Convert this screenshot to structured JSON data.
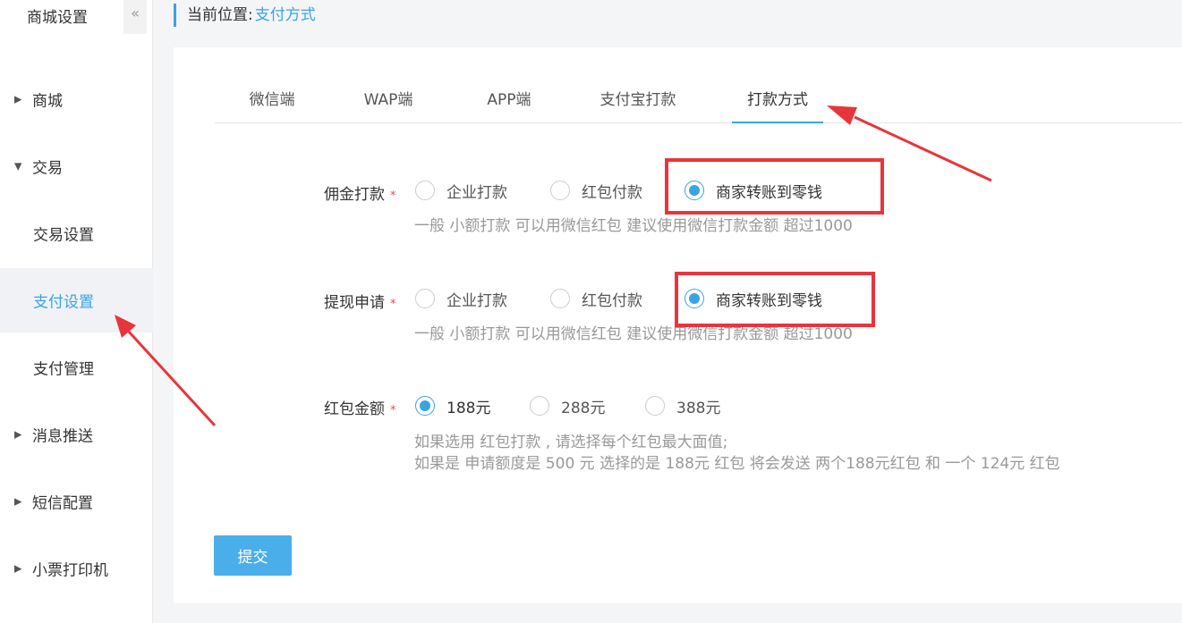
{
  "sidebar": {
    "title": "商城设置",
    "collapse_icon": "«",
    "items": [
      {
        "label": "商城",
        "arrow": "▶"
      },
      {
        "label": "交易",
        "arrow": "▼"
      },
      {
        "label": "交易设置"
      },
      {
        "label": "支付设置"
      },
      {
        "label": "支付管理"
      },
      {
        "label": "消息推送",
        "arrow": "▶"
      },
      {
        "label": "短信配置",
        "arrow": "▶"
      },
      {
        "label": "小票打印机",
        "arrow": "▶"
      }
    ]
  },
  "breadcrumb": {
    "prefix": "当前位置:",
    "current": "支付方式"
  },
  "tabs": [
    "微信端",
    "WAP端",
    "APP端",
    "支付宝打款",
    "打款方式"
  ],
  "form": {
    "commission": {
      "label": "佣金打款",
      "required": "*",
      "options": [
        "企业打款",
        "红包付款",
        "商家转账到零钱"
      ],
      "selected": "商家转账到零钱",
      "hint": "一般 小额打款 可以用微信红包 建议使用微信打款金额 超过1000"
    },
    "withdraw": {
      "label": "提现申请",
      "required": "*",
      "options": [
        "企业打款",
        "红包付款",
        "商家转账到零钱"
      ],
      "selected": "商家转账到零钱",
      "hint": "一般 小额打款 可以用微信红包 建议使用微信打款金额 超过1000"
    },
    "redpacket": {
      "label": "红包金额",
      "required": "*",
      "options": [
        "188元",
        "288元",
        "388元"
      ],
      "selected": "188元",
      "hint_lines": [
        "如果选用 红包打款 , 请选择每个红包最大面值;",
        "如果是 申请额度是 500 元 选择的是 188元 红包 将会发送 两个188元红包 和 一个 124元 红包"
      ]
    }
  },
  "submit_label": "提交",
  "colors": {
    "accent": "#3aa3e3",
    "annotation": "#e8353b",
    "button": "#4aaeea"
  }
}
